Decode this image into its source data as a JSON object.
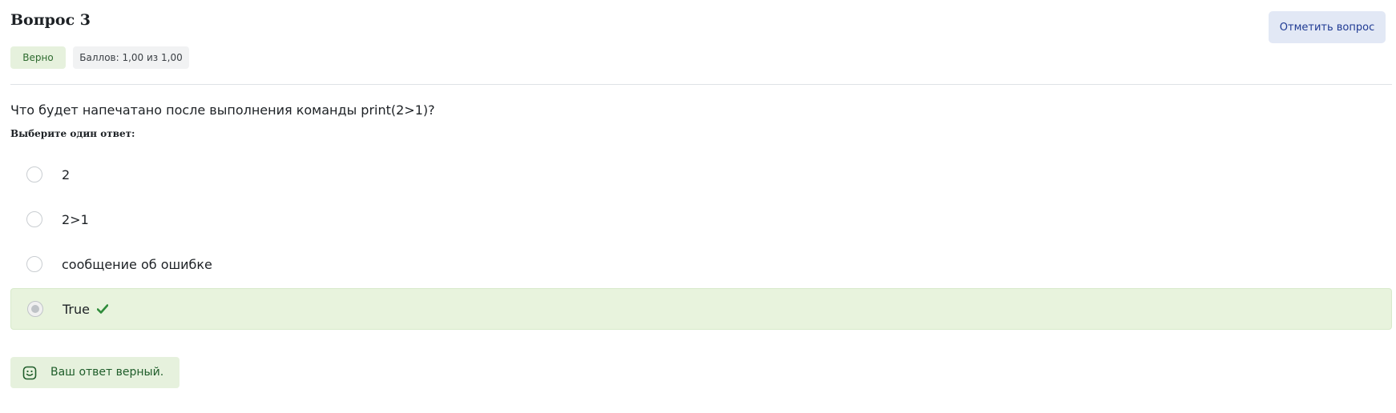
{
  "question": {
    "title": "Вопрос 3",
    "flag_label": "Отметить вопрос",
    "state": "Верно",
    "grade": "Баллов: 1,00 из 1,00",
    "text": "Что будет напечатано после выполнения команды print(2>1)?",
    "prompt": "Выберите один ответ:"
  },
  "answers": [
    {
      "label": "2",
      "selected": false,
      "correct": false
    },
    {
      "label": "2>1",
      "selected": false,
      "correct": false
    },
    {
      "label": "сообщение об ошибке",
      "selected": false,
      "correct": false
    },
    {
      "label": "True",
      "selected": true,
      "correct": true
    }
  ],
  "feedback": {
    "text": "Ваш ответ верный.",
    "icon": "smile-icon"
  },
  "colors": {
    "correct_bg": "#e8f3dd",
    "correct_text": "#1f5d2a",
    "flag_bg": "#e2e8f5",
    "flag_text": "#1f3a93",
    "check_green": "#2e8b3a"
  }
}
